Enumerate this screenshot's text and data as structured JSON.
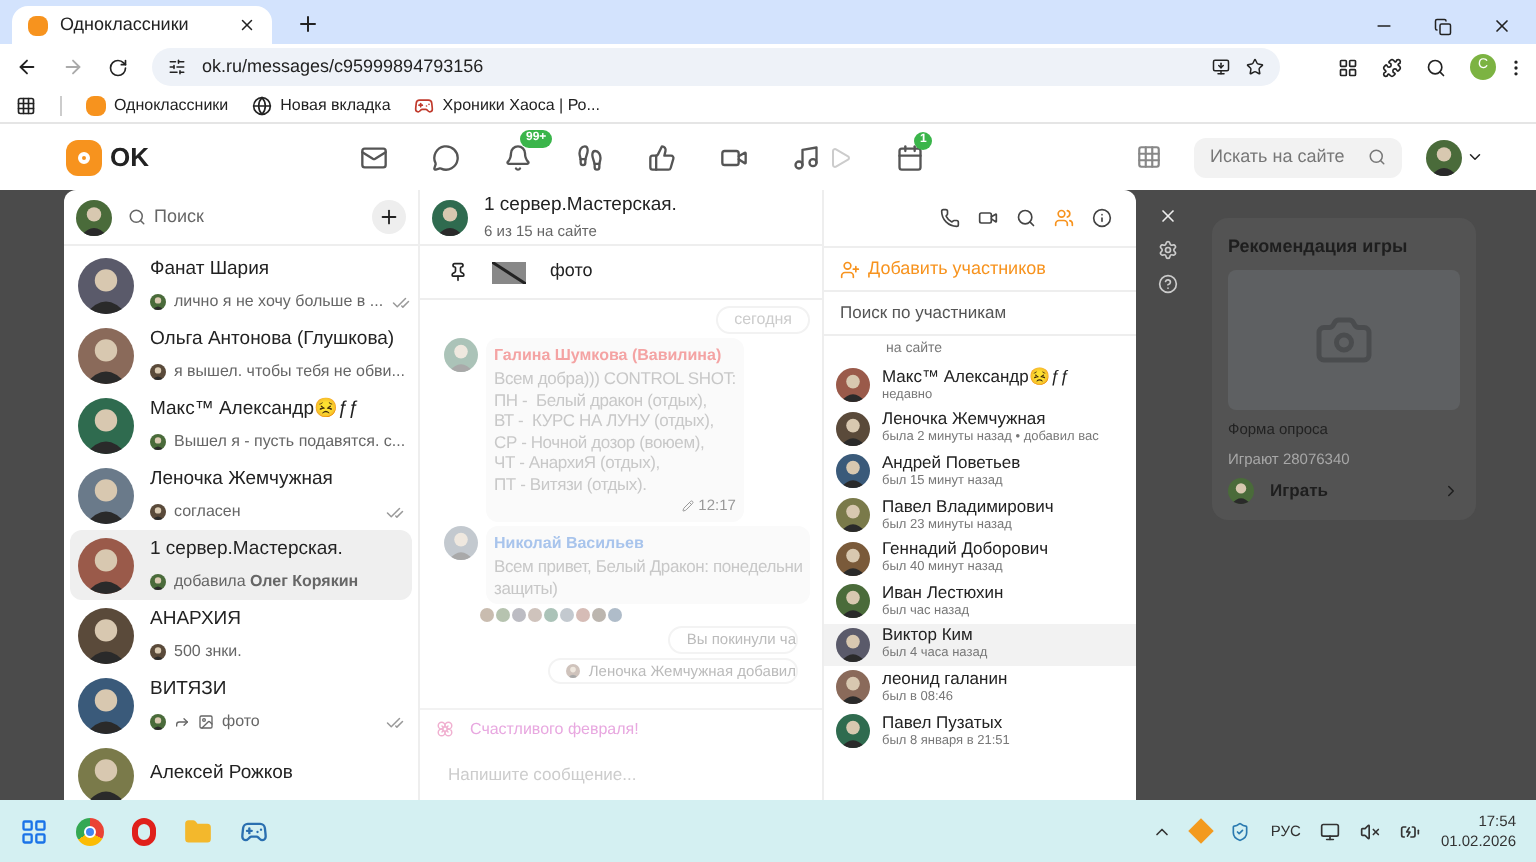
{
  "browser": {
    "tab_title": "Одноклассники",
    "url": "ok.ru/messages/c95999894793156",
    "profile_initial": "C",
    "bookmarks": [
      {
        "label": "Одноклассники",
        "kind": "ok"
      },
      {
        "label": "Новая вкладка",
        "kind": "globe"
      },
      {
        "label": "Хроники Хаоса | Ро...",
        "kind": "game"
      }
    ]
  },
  "header": {
    "logo": "OK",
    "notifications_badge": "99+",
    "events_badge": "1",
    "search": {
      "placeholder": "Искать на сайте"
    }
  },
  "chat_list": {
    "search_placeholder": "Поиск",
    "chats": [
      {
        "name": "Фанат Шария",
        "preview": "лично я не хочу больше в ...",
        "kind": "text",
        "read": true,
        "selected": false
      },
      {
        "name": "Ольга Антонова (Глушкова)",
        "preview": "я вышел. чтобы тебя не обви...",
        "kind": "text",
        "read": false,
        "selected": false
      },
      {
        "name": "Макс™ Александр😣ƒƒ",
        "preview": "Вышел я - пусть подавятся. с...",
        "kind": "text",
        "read": false,
        "selected": false
      },
      {
        "name": "Леночка Жемчужная",
        "preview": "согласен",
        "kind": "text",
        "read": true,
        "selected": false
      },
      {
        "name": "1 сервер.Мастерская.",
        "preview": "добавила **Олег Корякин**",
        "kind": "text",
        "read": false,
        "selected": true
      },
      {
        "name": "АНАРХИЯ",
        "preview": "500 знки.",
        "kind": "text",
        "read": false,
        "selected": false
      },
      {
        "name": "ВИТЯЗИ",
        "preview": "фото",
        "kind": "forwarded_photo",
        "read": true,
        "selected": false
      },
      {
        "name": "Алексей Рожков",
        "kind": "text",
        "read": false,
        "selected": false
      }
    ]
  },
  "chat": {
    "title": "1 сервер.Мастерская.",
    "subtitle": "6 из 15 на сайте",
    "pinned": "фото",
    "timeline": [
      {
        "kind": "date",
        "text": "сегодня"
      },
      {
        "kind": "message",
        "author": "Галина Шумкова (Вавилина)",
        "color": "#f4a3a3",
        "lines": [
          "Всем добра))) CONTROL SHOT:",
          "ПН -  Белый дракон (отдых),",
          "ВТ -  КУРС НА ЛУНУ (отдых),",
          "СР - Ночной дозор (воюем),",
          "ЧТ - АнархиЯ (отдых),",
          "ПТ - Витязи (отдых)."
        ],
        "time": "12:17",
        "edited": true
      },
      {
        "kind": "message",
        "author": "Николай Васильев",
        "color": "#a8c4ec",
        "lines": [
          "Всем привет, Белый Дракон: понедельни",
          "защиты)"
        ]
      },
      {
        "kind": "reactions"
      },
      {
        "kind": "system",
        "text": "Вы покинули ча"
      },
      {
        "kind": "system",
        "text": "Леночка Жемчужная добавил",
        "avatar": true
      }
    ],
    "greeting": "Счастливого февраля!",
    "input_placeholder": "Напишите сообщение..."
  },
  "participants": {
    "add_label": "Добавить участников",
    "search_placeholder": "Поиск по участникам",
    "members": [
      {
        "status": "на сайте",
        "selected": false
      },
      {
        "name": "Макс™ Александр😣ƒƒ",
        "status": "недавно",
        "selected": false
      },
      {
        "name": "Леночка Жемчужная",
        "status": "была 2 минуты назад • добавил вас",
        "selected": false
      },
      {
        "name": "Андрей Поветьев",
        "status": "был 15 минут назад",
        "selected": false
      },
      {
        "name": "Павел Владимирович",
        "status": "был 23 минуты назад",
        "selected": false
      },
      {
        "name": "Геннадий Доборович",
        "status": "был 40 минут назад",
        "selected": false
      },
      {
        "name": "Иван Лестюхин",
        "status": "был час назад",
        "selected": false
      },
      {
        "name": "Виктор Ким",
        "status": "был 4 часа назад",
        "selected": true
      },
      {
        "name": "леонид галанин",
        "status": "был в 08:46",
        "selected": false
      },
      {
        "name": "Павел Пузатых",
        "status": "был 8 января в 21:51",
        "selected": false
      }
    ]
  },
  "game_card": {
    "title": "Рекомендация игры",
    "name": "Форма опроса",
    "players": "Играют 28076340",
    "play": "Играть"
  },
  "taskbar": {
    "language": "РУС",
    "time": "17:54",
    "date": "01.02.2026"
  }
}
